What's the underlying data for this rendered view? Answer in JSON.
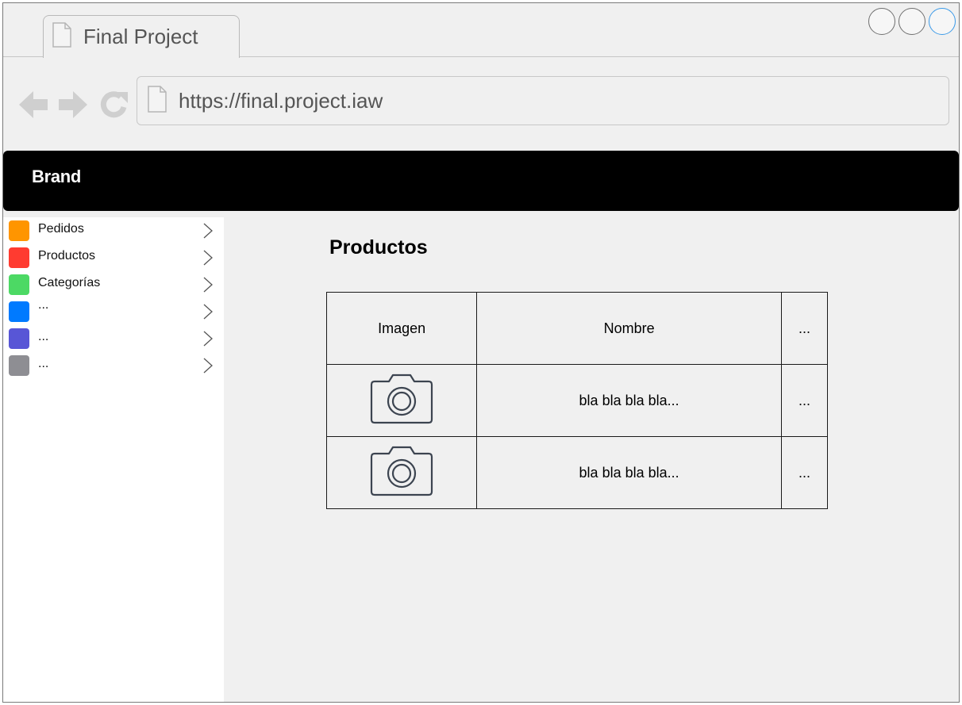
{
  "browser": {
    "tab_title": "Final Project",
    "url": "https://final.project.iaw"
  },
  "navbar": {
    "brand": "Brand"
  },
  "sidebar": {
    "items": [
      {
        "label": "Pedidos",
        "color": "#ff9500"
      },
      {
        "label": "Productos",
        "color": "#ff3b30"
      },
      {
        "label": "Categorías",
        "color": "#4cd964"
      },
      {
        "label": "...",
        "color": "#007aff"
      },
      {
        "label": "...",
        "color": "#5856d6"
      },
      {
        "label": "...",
        "color": "#8e8e93"
      }
    ]
  },
  "main": {
    "title": "Productos",
    "table": {
      "headers": [
        "Imagen",
        "Nombre",
        "..."
      ],
      "rows": [
        {
          "image": "camera-icon",
          "name": "bla bla bla bla...",
          "more": "..."
        },
        {
          "image": "camera-icon",
          "name": "bla bla bla bla...",
          "more": "..."
        }
      ]
    }
  }
}
